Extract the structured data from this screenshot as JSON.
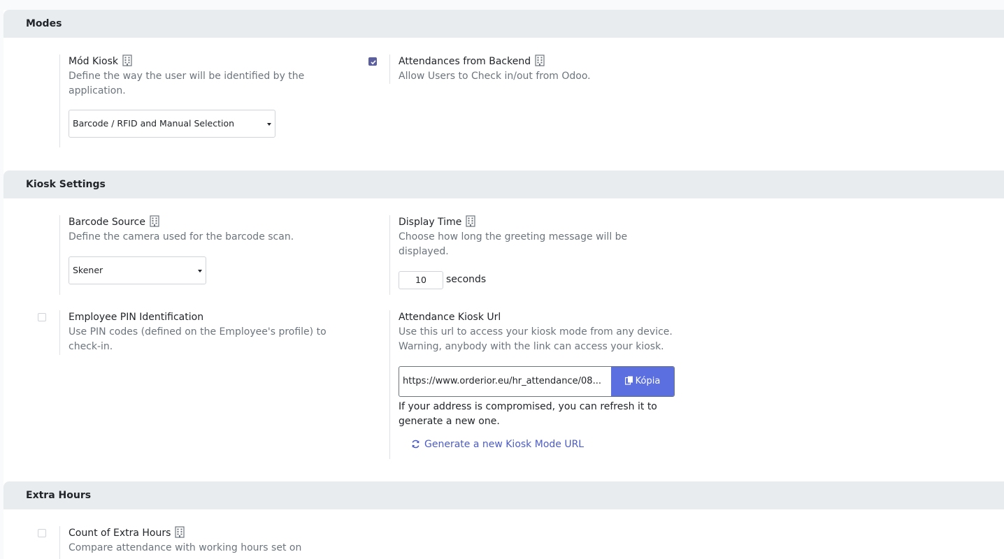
{
  "sections": {
    "modes": "Modes",
    "kiosk_settings": "Kiosk Settings",
    "extra_hours": "Extra Hours"
  },
  "mod_kiosk": {
    "label": "Mód Kiosk",
    "description": "Define the way the user will be identified by the application.",
    "selected": "Barcode / RFID and Manual Selection"
  },
  "attendances_backend": {
    "label": "Attendances from Backend",
    "description": "Allow Users to Check in/out from Odoo.",
    "checked": true
  },
  "barcode_source": {
    "label": "Barcode Source",
    "description": "Define the camera used for the barcode scan.",
    "selected": "Skener"
  },
  "display_time": {
    "label": "Display Time",
    "description": "Choose how long the greeting message will be displayed.",
    "value": "10",
    "unit": "seconds"
  },
  "employee_pin": {
    "label": "Employee PIN Identification",
    "description": "Use PIN codes (defined on the Employee's profile) to check-in.",
    "checked": false
  },
  "kiosk_url": {
    "label": "Attendance Kiosk Url",
    "description_line1": "Use this url to access your kiosk mode from any device.",
    "description_line2": "Warning, anybody with the link can access your kiosk.",
    "url": "https://www.orderior.eu/hr_attendance/08...",
    "copy_label": "Kópia",
    "note": "If your address is compromised, you can refresh it to generate a new one.",
    "generate_label": "Generate a new Kiosk Mode URL"
  },
  "extra_hours_setting": {
    "label": "Count of Extra Hours",
    "description": "Compare attendance with working hours set on",
    "checked": false
  },
  "colors": {
    "accent": "#5c6fe0",
    "checkbox_checked": "#5b5f9e",
    "link": "#4c5cc4",
    "section_bg": "#e9ecef"
  }
}
